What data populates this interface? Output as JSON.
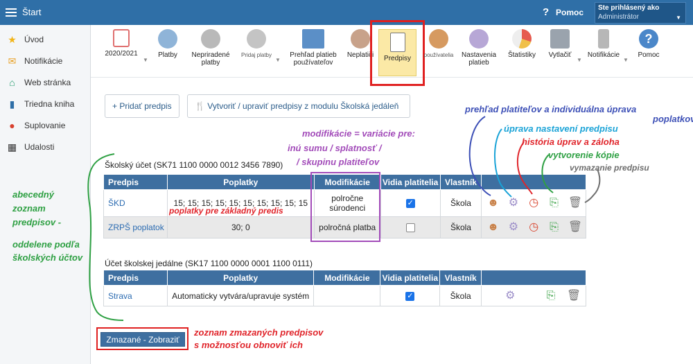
{
  "topbar": {
    "title": "Štart",
    "help_label": "Pomoc",
    "login_line1": "Ste prihlásený ako",
    "login_line2": "Administrátor"
  },
  "sidebar": {
    "items": [
      {
        "label": "Úvod",
        "icon": "star-icon"
      },
      {
        "label": "Notifikácie",
        "icon": "envelope-icon"
      },
      {
        "label": "Web stránka",
        "icon": "house-icon"
      },
      {
        "label": "Triedna kniha",
        "icon": "book-icon"
      },
      {
        "label": "Suplovanie",
        "icon": "person-icon"
      },
      {
        "label": "Udalosti",
        "icon": "calendar-icon"
      }
    ]
  },
  "toolbar": {
    "items": [
      {
        "label": "2020/2021",
        "icon": "calendar-icon"
      },
      {
        "label": "Platby",
        "icon": "money-bag-icon"
      },
      {
        "label": "Nepriradené platby",
        "icon": "money-bag-question-icon"
      },
      {
        "label": "Pridaj platby",
        "icon": "money-bag-plus-icon"
      },
      {
        "label": "Prehľad platieb používateľov",
        "icon": "ledger-icon"
      },
      {
        "label": "Neplatiči",
        "icon": "money-bag-red-icon"
      },
      {
        "label": "Predpisy",
        "icon": "document-euro-icon"
      },
      {
        "label": "používatelia",
        "icon": "person-icon"
      },
      {
        "label": "Nastavenia platieb",
        "icon": "gear-icon"
      },
      {
        "label": "Štatistiky",
        "icon": "pie-chart-icon"
      },
      {
        "label": "Vytlačiť",
        "icon": "printer-icon"
      },
      {
        "label": "Notifikácie",
        "icon": "phone-icon"
      },
      {
        "label": "Pomoc",
        "icon": "help-icon"
      }
    ]
  },
  "actions": {
    "add_label": "Pridať predpis",
    "jedalen_label": "Vytvoriť / upraviť predpisy z modulu Školská jedáleň"
  },
  "tables": {
    "headers": [
      "Predpis",
      "Poplatky",
      "Modifikácie",
      "Vidia platitelia",
      "Vlastník"
    ],
    "school": {
      "title": "Školský účet (SK71 1100 0000 0012 3456 7890)",
      "rows": [
        {
          "name": "ŠKD",
          "fees": "15; 15; 15; 15; 15; 15; 15; 15; 15; 15",
          "mods": "polročne súrodenci",
          "visible": true,
          "owner": "Škola"
        },
        {
          "name": "ZRPŠ poplatok",
          "fees": "30; 0",
          "mods": "polročná platba",
          "visible": false,
          "owner": "Škola"
        }
      ]
    },
    "canteen": {
      "title": "Účet školskej jedálne (SK17 1100 0000 0001 1100 0111)",
      "rows": [
        {
          "name": "Strava",
          "fees": "Automaticky vytvára/upravuje systém",
          "mods": "",
          "visible": true,
          "owner": "Škola"
        }
      ]
    }
  },
  "deleted_button": "Zmazané - Zobraziť",
  "annotations": {
    "left1": "abecedný",
    "left2": "zoznam",
    "left3": "predpisov -",
    "left4": "oddelene podľa",
    "left5": "školských účtov",
    "mod1": "modifikácie = variácie pre:",
    "mod2": "inú sumu  /  splatnosť  /",
    "mod3": "/  skupinu platiteľov",
    "fees": "poplatky pre základný predis",
    "overview1": "prehľad platiteľov a individuálna úprava",
    "overview2": "poplatkov",
    "settings": "úprava nastavení predpisu",
    "history": "história úprav a záloha",
    "copy": "vytvorenie kópie",
    "delete": "vymazanie predpisu",
    "deleted1": "zoznam zmazaných predpisov",
    "deleted2": "s možnosťou obnoviť ich"
  }
}
